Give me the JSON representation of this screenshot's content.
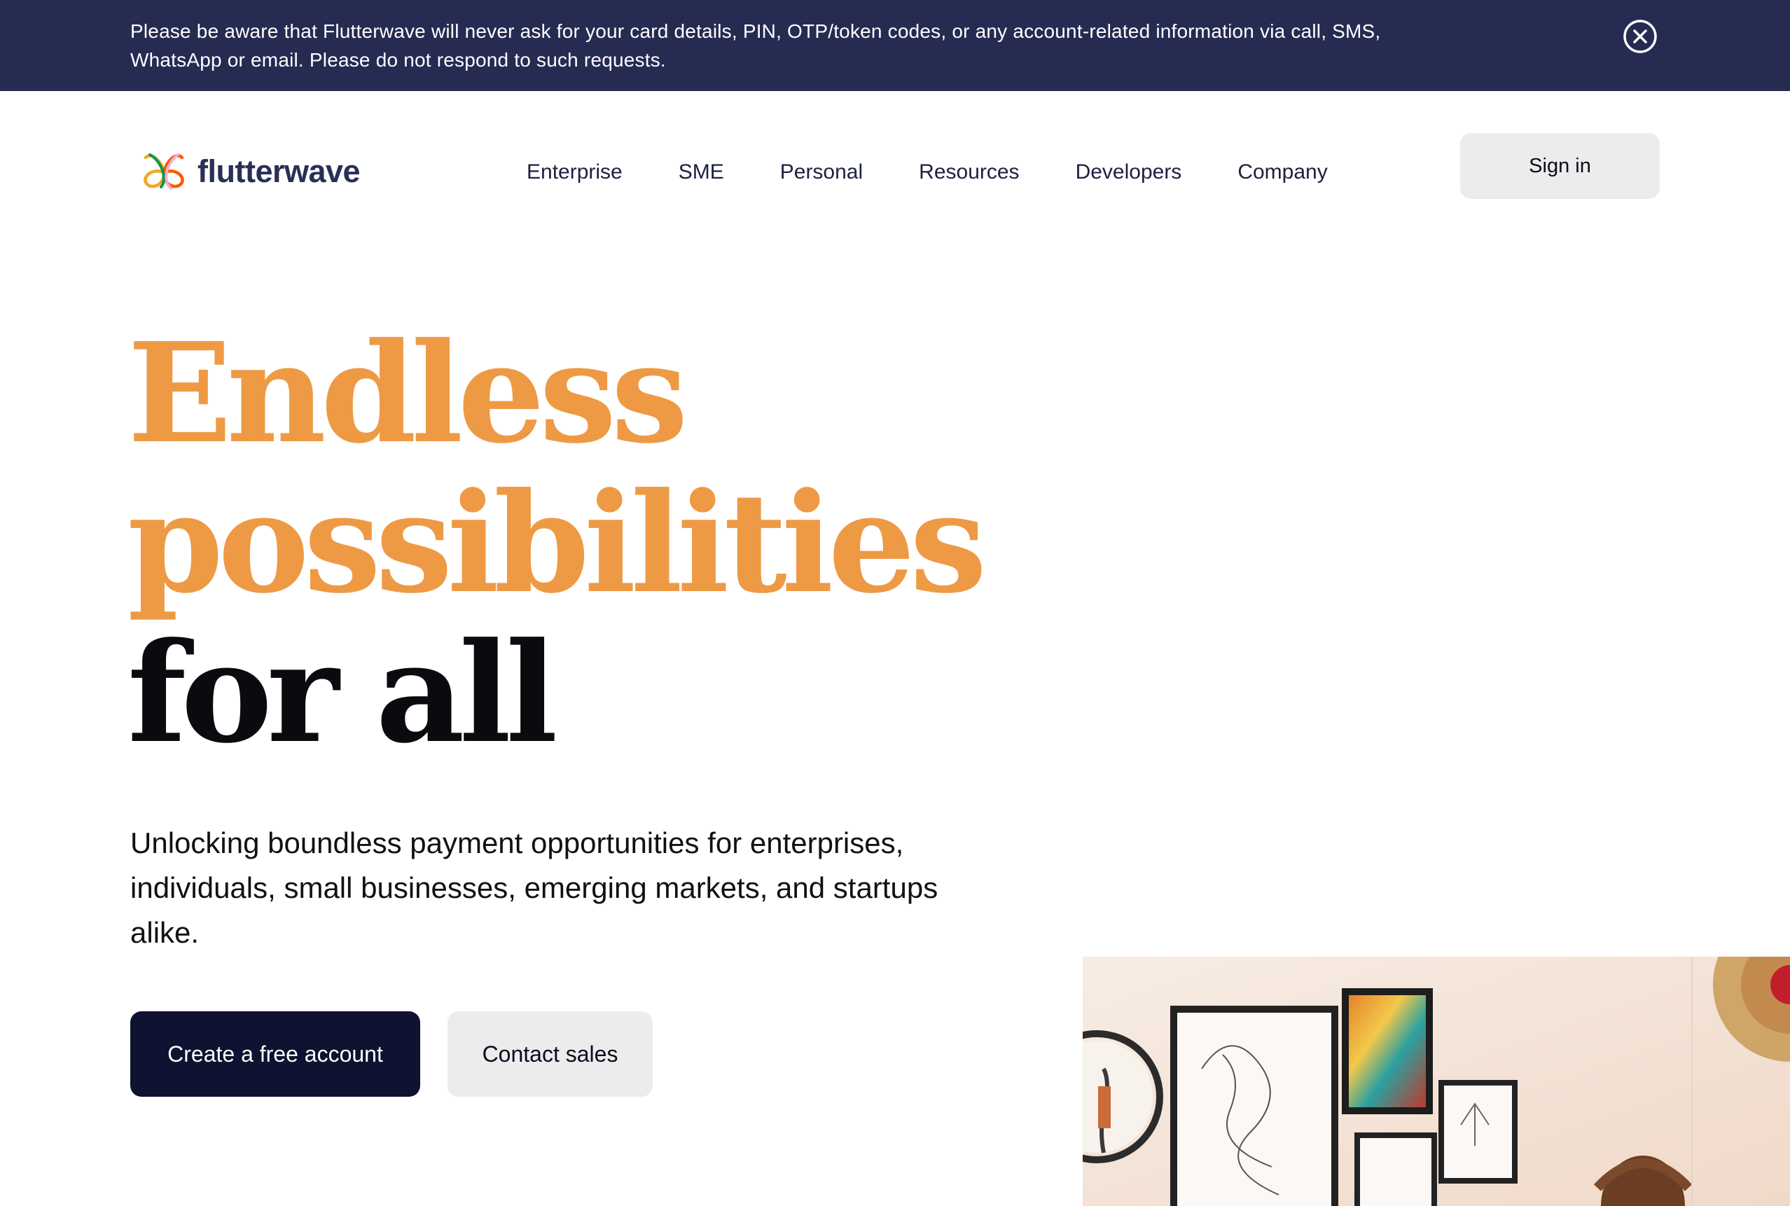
{
  "notice": {
    "text": "Please be aware that Flutterwave will never ask for your card details, PIN, OTP/token codes, or any account-related information via call, SMS, WhatsApp or email. Please do not respond to such requests.",
    "close_icon": "close-circle-icon"
  },
  "header": {
    "logo_text": "flutterwave",
    "nav": [
      "Enterprise",
      "SME",
      "Personal",
      "Resources",
      "Developers",
      "Company"
    ],
    "signin_label": "Sign in"
  },
  "hero": {
    "title_line1": "Endless",
    "title_line2": "possibilities",
    "title_line3": "for all",
    "subtitle": "Unlocking boundless payment opportunities for enterprises, individuals, small businesses, emerging markets, and startups alike.",
    "primary_cta": "Create a free account",
    "secondary_cta": "Contact sales"
  },
  "colors": {
    "banner_bg": "#262b52",
    "accent_orange": "#ee9a45",
    "primary_button": "#0f1230",
    "secondary_button": "#ececec"
  }
}
